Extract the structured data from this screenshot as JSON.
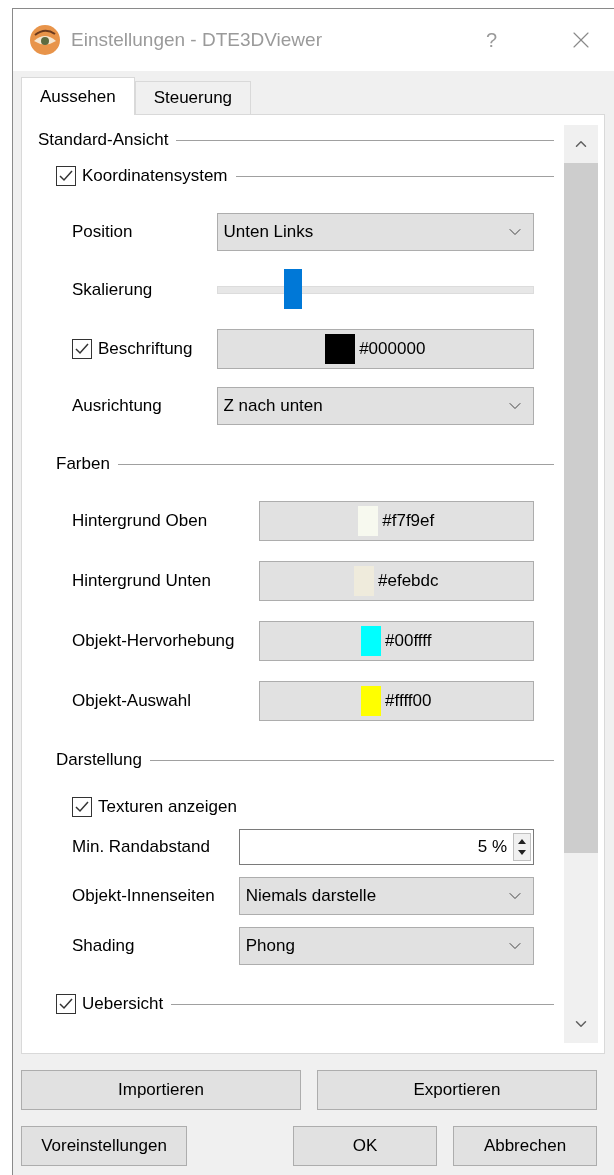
{
  "window": {
    "title": "Einstellungen - DTE3DViewer",
    "help": "?"
  },
  "tabs": [
    {
      "label": "Aussehen",
      "selected": true
    },
    {
      "label": "Steuerung",
      "selected": false
    }
  ],
  "sections": [
    {
      "kind": "group",
      "title": "Standard-Ansicht",
      "children": [
        {
          "kind": "check_group",
          "title": "Koordinatensystem",
          "checked": true,
          "children": [
            {
              "kind": "dropdown",
              "label": "Position",
              "value": "Unten Links"
            },
            {
              "kind": "slider",
              "label": "Skalierung",
              "level": 0.24
            },
            {
              "kind": "check_color",
              "label": "Beschriftung",
              "checked": true,
              "color": "#000000",
              "value": "#000000"
            },
            {
              "kind": "dropdown",
              "label": "Ausrichtung",
              "value": "Z nach unten"
            }
          ]
        },
        {
          "kind": "group",
          "title": "Farben",
          "children": [
            {
              "kind": "color",
              "label": "Hintergrund Oben",
              "color": "#f7f9ef",
              "value": "#f7f9ef"
            },
            {
              "kind": "color",
              "label": "Hintergrund Unten",
              "color": "#efebdc",
              "value": "#efebdc"
            },
            {
              "kind": "color",
              "label": "Objekt-Hervorhebung",
              "color": "#00ffff",
              "value": "#00ffff"
            },
            {
              "kind": "color",
              "label": "Objekt-Auswahl",
              "color": "#ffff00",
              "value": "#ffff00"
            }
          ]
        },
        {
          "kind": "group",
          "title": "Darstellung",
          "children": [
            {
              "kind": "check",
              "label": "Texturen anzeigen",
              "checked": true
            },
            {
              "kind": "spin",
              "label": "Min. Randabstand",
              "value": "5 %"
            },
            {
              "kind": "dropdown",
              "label": "Objekt-Innenseiten",
              "value": "Niemals darstelle"
            },
            {
              "kind": "dropdown",
              "label": "Shading",
              "value": "Phong"
            }
          ]
        },
        {
          "kind": "check_group",
          "title": "Uebersicht",
          "checked": true
        }
      ]
    }
  ],
  "actions_top": [
    "Importieren",
    "Exportieren"
  ],
  "actions_bottom": [
    "Voreinstellungen",
    "OK",
    "Abbrechen"
  ]
}
